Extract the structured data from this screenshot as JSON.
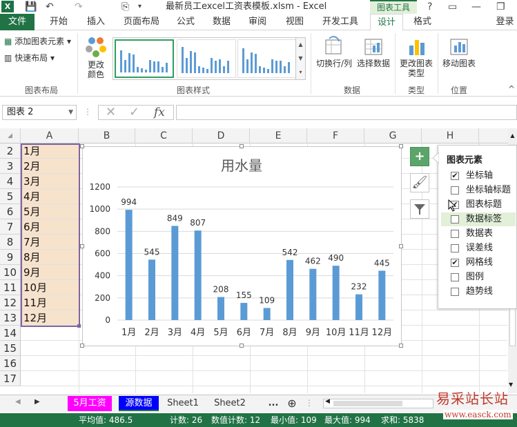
{
  "app": {
    "title": "最新员工excel工资表模板.xlsm - Excel",
    "context_tab": "图表工具",
    "logo": "X",
    "login": "登录"
  },
  "quick_access": {
    "save": "💾",
    "undo": "↶",
    "redo": "↷",
    "camera": "⎘",
    "more": "▾"
  },
  "tabs": [
    {
      "label": "文件"
    },
    {
      "label": "开始"
    },
    {
      "label": "插入"
    },
    {
      "label": "页面布局"
    },
    {
      "label": "公式"
    },
    {
      "label": "数据"
    },
    {
      "label": "审阅"
    },
    {
      "label": "视图"
    },
    {
      "label": "开发工具"
    },
    {
      "label": "设计"
    },
    {
      "label": "格式"
    }
  ],
  "ribbon": {
    "add_element": "添加图表元素",
    "quick_layout": "快速布局",
    "change_color": "更改颜色",
    "group_layout": "图表布局",
    "group_styles": "图表样式",
    "switch_row_col": "切换行/列",
    "select_data": "选择数据",
    "group_data": "数据",
    "change_type": "更改图表类型",
    "group_type": "类型",
    "move_chart": "移动图表",
    "group_location": "位置"
  },
  "formula_bar": {
    "name_box": "图表 2",
    "fx": "fx",
    "cancel": "✕",
    "enter": "✓",
    "value": ""
  },
  "columns": [
    "A",
    "B",
    "C",
    "D",
    "E",
    "F",
    "G",
    "H"
  ],
  "rows": [
    "2",
    "3",
    "4",
    "5",
    "6",
    "7",
    "8",
    "9",
    "10",
    "11",
    "12",
    "13",
    "14",
    "15",
    "16",
    "17"
  ],
  "months": [
    "1月",
    "2月",
    "3月",
    "4月",
    "5月",
    "6月",
    "7月",
    "8月",
    "9月",
    "10月",
    "11月",
    "12月"
  ],
  "chart_data": {
    "type": "bar",
    "title": "用水量",
    "categories": [
      "1月",
      "2月",
      "3月",
      "4月",
      "5月",
      "6月",
      "7月",
      "8月",
      "9月",
      "10月",
      "11月",
      "12月"
    ],
    "values": [
      994,
      545,
      849,
      807,
      208,
      155,
      109,
      542,
      462,
      490,
      232,
      445
    ],
    "ylim": [
      0,
      1200
    ],
    "yticks": [
      0,
      200,
      400,
      600,
      800,
      1000,
      1200
    ],
    "grid": true,
    "legend": "none",
    "bar_color": "#5b9bd5"
  },
  "chart_elements": {
    "title": "图表元素",
    "items": [
      {
        "label": "坐标轴",
        "checked": true
      },
      {
        "label": "坐标轴标题",
        "checked": false
      },
      {
        "label": "图表标题",
        "checked": true
      },
      {
        "label": "数据标签",
        "checked": false
      },
      {
        "label": "数据表",
        "checked": false
      },
      {
        "label": "误差线",
        "checked": false
      },
      {
        "label": "网格线",
        "checked": true
      },
      {
        "label": "图例",
        "checked": false
      },
      {
        "label": "趋势线",
        "checked": false
      }
    ]
  },
  "sheets": [
    {
      "label": "5月工资",
      "color": "#ff00ff",
      "text_color": "#ffffff"
    },
    {
      "label": "源数据",
      "color": "#0000ff",
      "text_color": "#ffffff"
    },
    {
      "label": "Sheet1",
      "color": "",
      "text_color": "#333333"
    },
    {
      "label": "Sheet2",
      "color": "",
      "text_color": "#333333"
    }
  ],
  "sheet_more": "...",
  "status": {
    "average": "平均值: 486.5",
    "count": "计数: 26",
    "numeric_count": "数值计数: 12",
    "min": "最小值: 109",
    "max": "最大值: 994",
    "sum": "求和: 5838"
  },
  "watermark": {
    "line1": "易采站长站",
    "line2": "www.easck.com"
  },
  "colors": {
    "excel_green": "#217346",
    "month_fill": "#f7e2cc",
    "selection": "#8064a2"
  }
}
